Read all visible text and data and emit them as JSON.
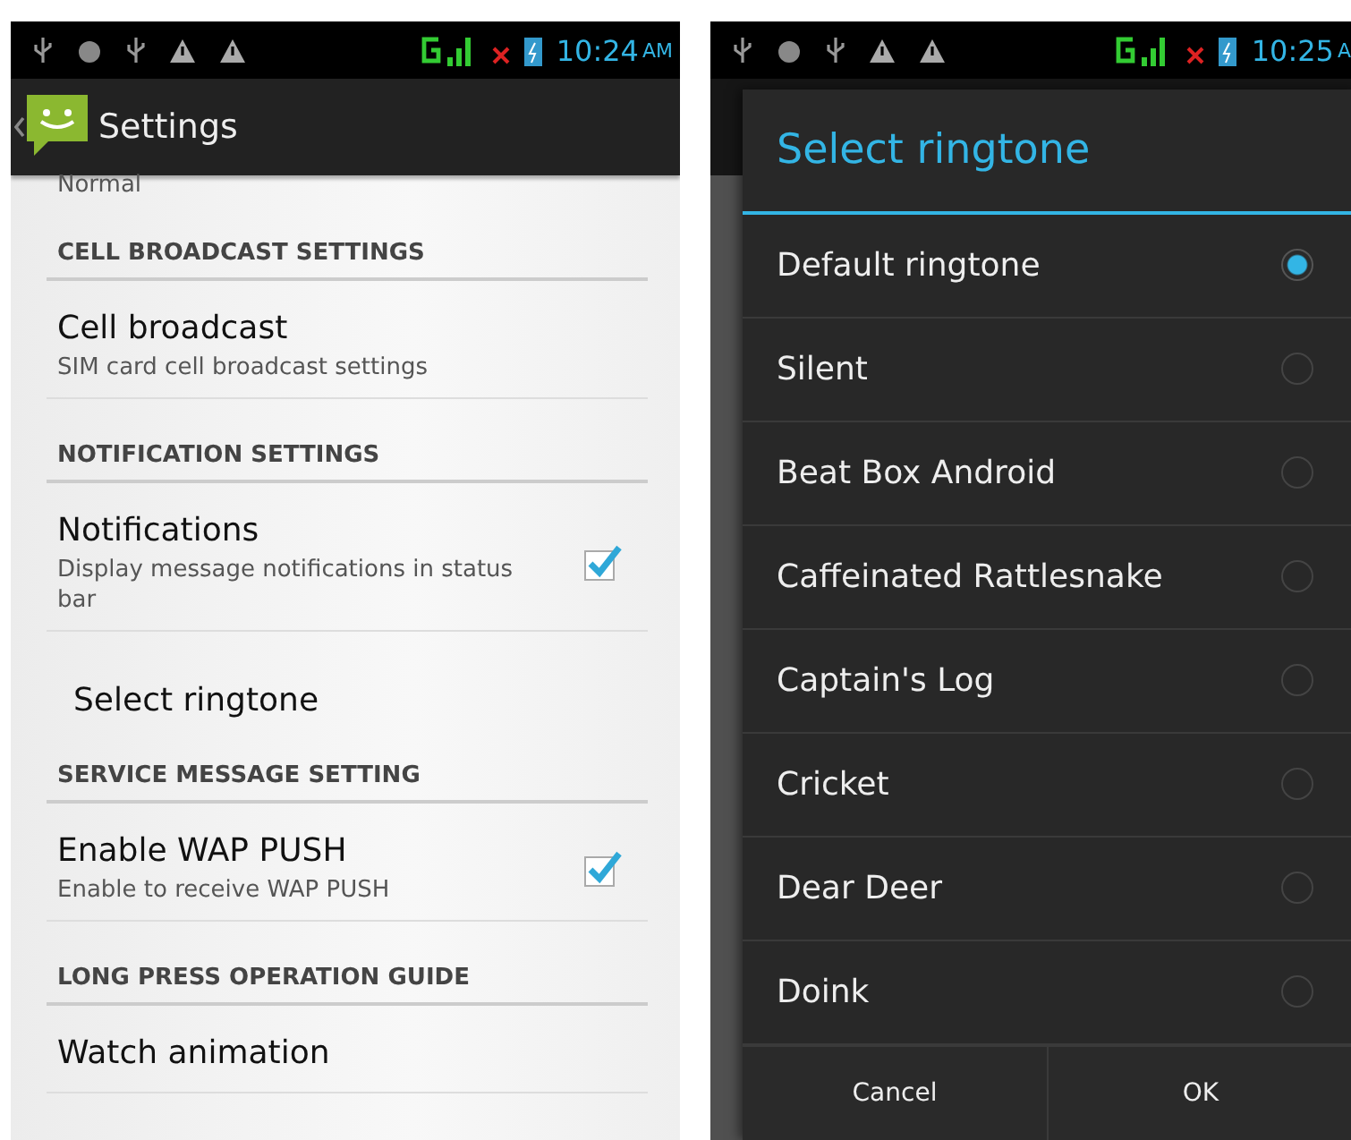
{
  "left_screen": {
    "status_bar": {
      "time": "10:24",
      "ampm": "AM"
    },
    "action_bar": {
      "title": "Settings"
    },
    "items": [
      {
        "kind": "summary",
        "text": "Normal"
      },
      {
        "kind": "header",
        "title": "CELL BROADCAST SETTINGS"
      },
      {
        "kind": "pref",
        "title": "Cell broadcast",
        "summary": "SIM card cell broadcast settings"
      },
      {
        "kind": "header",
        "title": "NOTIFICATION SETTINGS"
      },
      {
        "kind": "check",
        "title": "Notifications",
        "summary": "Display message notifications in status bar",
        "checked": true
      },
      {
        "kind": "simple",
        "title": "Select ringtone"
      },
      {
        "kind": "header",
        "title": "SERVICE MESSAGE SETTING"
      },
      {
        "kind": "check",
        "title": "Enable WAP PUSH",
        "summary": "Enable to receive WAP PUSH",
        "checked": true
      },
      {
        "kind": "header",
        "title": "LONG PRESS OPERATION GUIDE"
      },
      {
        "kind": "pref",
        "title": "Watch animation"
      }
    ]
  },
  "right_screen": {
    "status_bar": {
      "time": "10:25",
      "ampm": "A"
    },
    "dialog": {
      "title": "Select ringtone",
      "options": [
        {
          "label": "Default ringtone",
          "selected": true
        },
        {
          "label": "Silent",
          "selected": false
        },
        {
          "label": "Beat Box Android",
          "selected": false
        },
        {
          "label": "Caffeinated Rattlesnake",
          "selected": false
        },
        {
          "label": "Captain's Log",
          "selected": false
        },
        {
          "label": "Cricket",
          "selected": false
        },
        {
          "label": "Dear Deer",
          "selected": false
        },
        {
          "label": "Doink",
          "selected": false
        }
      ],
      "buttons": [
        "Cancel",
        "OK"
      ]
    }
  }
}
